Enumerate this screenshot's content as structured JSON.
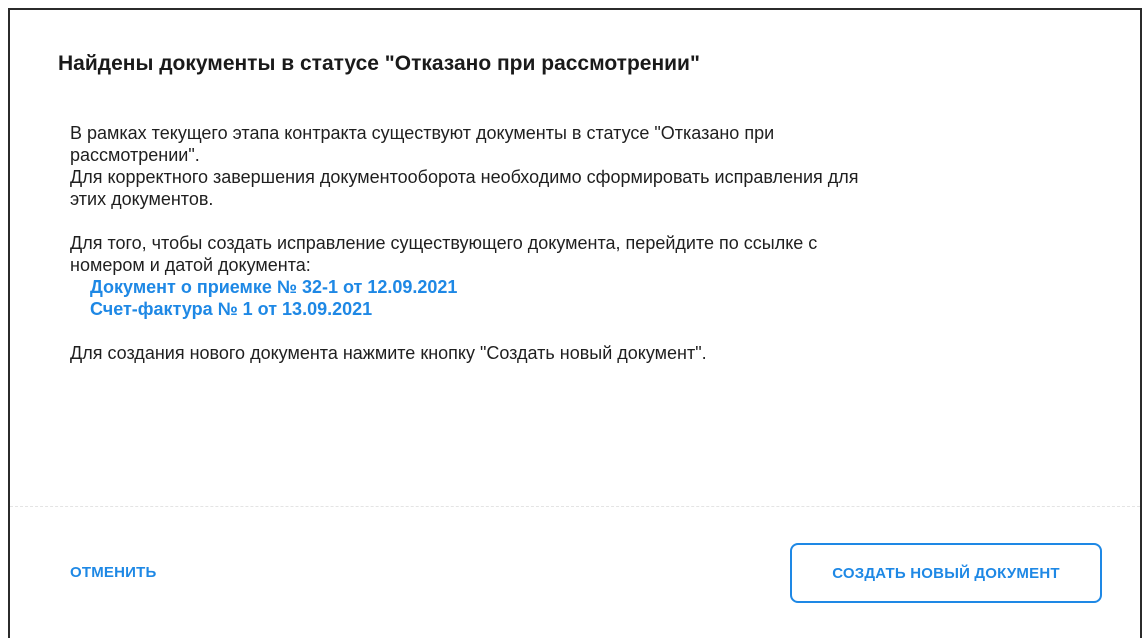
{
  "dialog": {
    "title": "Найдены документы в статусе \"Отказано при рассмотрении\"",
    "paragraph1_line1": "В рамках текущего этапа контракта существуют документы в статусе \"Отказано при",
    "paragraph1_line2": "рассмотрении\".",
    "paragraph1_line3": "Для корректного завершения документооборота необходимо сформировать исправления для",
    "paragraph1_line4": "этих документов.",
    "paragraph2_line1": "Для того, чтобы создать исправление существующего документа, перейдите по ссылке с",
    "paragraph2_line2": "номером и датой документа:",
    "links": [
      "Документ о приемке № 32-1 от 12.09.2021",
      "Счет-фактура № 1 от 13.09.2021"
    ],
    "paragraph3": "Для создания нового документа нажмите кнопку \"Создать новый документ\".",
    "cancel_label": "ОТМЕНИТЬ",
    "create_label": "СОЗДАТЬ НОВЫЙ ДОКУМЕНТ"
  },
  "colors": {
    "accent": "#1e88e5",
    "text": "#1f1f1f",
    "border": "#2b2b2b"
  }
}
